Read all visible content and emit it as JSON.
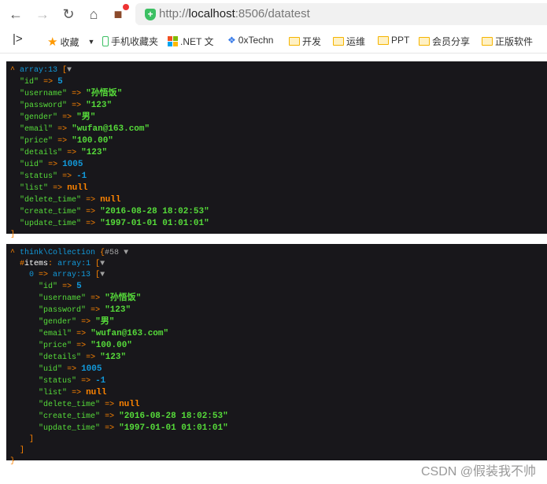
{
  "browser": {
    "url_prefix": "http://",
    "url_host": "localhost",
    "url_rest": ":8506/datatest",
    "bookmarks": [
      "收藏",
      "手机收藏夹",
      ".NET 文",
      "0xTechn",
      "开发",
      "运维",
      "PPT",
      "会员分享",
      "正版软件"
    ]
  },
  "dump1": {
    "header": "array:13",
    "rows": [
      [
        "id",
        "5",
        "n"
      ],
      [
        "username",
        "孙悟饭",
        "s"
      ],
      [
        "password",
        "123",
        "s"
      ],
      [
        "gender",
        "男",
        "s"
      ],
      [
        "email",
        "wufan@163.com",
        "s"
      ],
      [
        "price",
        "100.00",
        "s"
      ],
      [
        "details",
        "123",
        "s"
      ],
      [
        "uid",
        "1005",
        "n"
      ],
      [
        "status",
        "-1",
        "n"
      ],
      [
        "list",
        "null",
        "c"
      ],
      [
        "delete_time",
        "null",
        "c"
      ],
      [
        "create_time",
        "2016-08-28 18:02:53",
        "s"
      ],
      [
        "update_time",
        "1997-01-01 01:01:01",
        "s"
      ]
    ]
  },
  "dump2": {
    "class": "think\\Collection",
    "ref": "#58",
    "prop": "items",
    "prop_note": "array:1",
    "index": "0",
    "inner_note": "array:13"
  },
  "watermark": "CSDN @假装我不帅",
  "colors": {
    "bg": "#18171b",
    "key": "#56db3a",
    "arrow": "#ff8400",
    "number": "#1299da"
  }
}
